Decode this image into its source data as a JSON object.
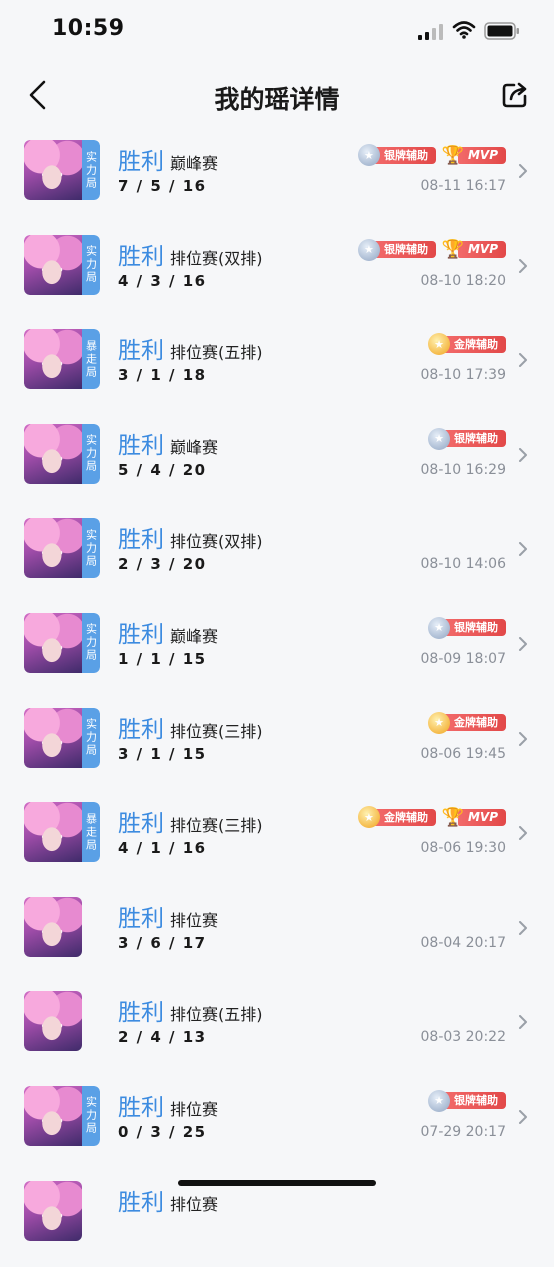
{
  "status_bar": {
    "time": "10:59"
  },
  "header": {
    "title": "我的瑶详情"
  },
  "matches": [
    {
      "result": "胜利",
      "mode": "巅峰赛",
      "kda": "7 / 5 / 16",
      "time": "08-11 16:17",
      "tag": "实力局",
      "badges": [
        {
          "type": "silver",
          "label": "银牌辅助"
        },
        {
          "type": "mvp",
          "label": "MVP"
        }
      ]
    },
    {
      "result": "胜利",
      "mode": "排位赛(双排)",
      "kda": "4 / 3 / 16",
      "time": "08-10 18:20",
      "tag": "实力局",
      "badges": [
        {
          "type": "silver",
          "label": "银牌辅助"
        },
        {
          "type": "mvp",
          "label": "MVP"
        }
      ]
    },
    {
      "result": "胜利",
      "mode": "排位赛(五排)",
      "kda": "3 / 1 / 18",
      "time": "08-10 17:39",
      "tag": "暴走局",
      "badges": [
        {
          "type": "gold",
          "label": "金牌辅助"
        }
      ]
    },
    {
      "result": "胜利",
      "mode": "巅峰赛",
      "kda": "5 / 4 / 20",
      "time": "08-10 16:29",
      "tag": "实力局",
      "badges": [
        {
          "type": "silver",
          "label": "银牌辅助"
        }
      ]
    },
    {
      "result": "胜利",
      "mode": "排位赛(双排)",
      "kda": "2 / 3 / 20",
      "time": "08-10 14:06",
      "tag": "实力局",
      "badges": []
    },
    {
      "result": "胜利",
      "mode": "巅峰赛",
      "kda": "1 / 1 / 15",
      "time": "08-09 18:07",
      "tag": "实力局",
      "badges": [
        {
          "type": "silver",
          "label": "银牌辅助"
        }
      ]
    },
    {
      "result": "胜利",
      "mode": "排位赛(三排)",
      "kda": "3 / 1 / 15",
      "time": "08-06 19:45",
      "tag": "实力局",
      "badges": [
        {
          "type": "gold",
          "label": "金牌辅助"
        }
      ]
    },
    {
      "result": "胜利",
      "mode": "排位赛(三排)",
      "kda": "4 / 1 / 16",
      "time": "08-06 19:30",
      "tag": "暴走局",
      "badges": [
        {
          "type": "gold",
          "label": "金牌辅助"
        },
        {
          "type": "mvp",
          "label": "MVP"
        }
      ]
    },
    {
      "result": "胜利",
      "mode": "排位赛",
      "kda": "3 / 6 / 17",
      "time": "08-04 20:17",
      "tag": "",
      "badges": []
    },
    {
      "result": "胜利",
      "mode": "排位赛(五排)",
      "kda": "2 / 4 / 13",
      "time": "08-03 20:22",
      "tag": "",
      "badges": []
    },
    {
      "result": "胜利",
      "mode": "排位赛",
      "kda": "0 / 3 / 25",
      "time": "07-29 20:17",
      "tag": "实力局",
      "badges": [
        {
          "type": "silver",
          "label": "银牌辅助"
        }
      ]
    },
    {
      "result": "胜利",
      "mode": "排位赛",
      "kda": "",
      "time": "",
      "tag": "",
      "badges": []
    }
  ]
}
